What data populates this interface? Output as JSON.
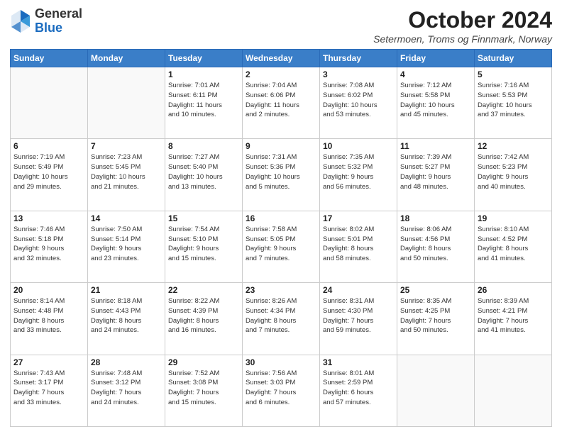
{
  "header": {
    "logo_general": "General",
    "logo_blue": "Blue",
    "month_title": "October 2024",
    "location": "Setermoen, Troms og Finnmark, Norway"
  },
  "days_of_week": [
    "Sunday",
    "Monday",
    "Tuesday",
    "Wednesday",
    "Thursday",
    "Friday",
    "Saturday"
  ],
  "weeks": [
    [
      {
        "day": "",
        "info": ""
      },
      {
        "day": "",
        "info": ""
      },
      {
        "day": "1",
        "info": "Sunrise: 7:01 AM\nSunset: 6:11 PM\nDaylight: 11 hours\nand 10 minutes."
      },
      {
        "day": "2",
        "info": "Sunrise: 7:04 AM\nSunset: 6:06 PM\nDaylight: 11 hours\nand 2 minutes."
      },
      {
        "day": "3",
        "info": "Sunrise: 7:08 AM\nSunset: 6:02 PM\nDaylight: 10 hours\nand 53 minutes."
      },
      {
        "day": "4",
        "info": "Sunrise: 7:12 AM\nSunset: 5:58 PM\nDaylight: 10 hours\nand 45 minutes."
      },
      {
        "day": "5",
        "info": "Sunrise: 7:16 AM\nSunset: 5:53 PM\nDaylight: 10 hours\nand 37 minutes."
      }
    ],
    [
      {
        "day": "6",
        "info": "Sunrise: 7:19 AM\nSunset: 5:49 PM\nDaylight: 10 hours\nand 29 minutes."
      },
      {
        "day": "7",
        "info": "Sunrise: 7:23 AM\nSunset: 5:45 PM\nDaylight: 10 hours\nand 21 minutes."
      },
      {
        "day": "8",
        "info": "Sunrise: 7:27 AM\nSunset: 5:40 PM\nDaylight: 10 hours\nand 13 minutes."
      },
      {
        "day": "9",
        "info": "Sunrise: 7:31 AM\nSunset: 5:36 PM\nDaylight: 10 hours\nand 5 minutes."
      },
      {
        "day": "10",
        "info": "Sunrise: 7:35 AM\nSunset: 5:32 PM\nDaylight: 9 hours\nand 56 minutes."
      },
      {
        "day": "11",
        "info": "Sunrise: 7:39 AM\nSunset: 5:27 PM\nDaylight: 9 hours\nand 48 minutes."
      },
      {
        "day": "12",
        "info": "Sunrise: 7:42 AM\nSunset: 5:23 PM\nDaylight: 9 hours\nand 40 minutes."
      }
    ],
    [
      {
        "day": "13",
        "info": "Sunrise: 7:46 AM\nSunset: 5:18 PM\nDaylight: 9 hours\nand 32 minutes."
      },
      {
        "day": "14",
        "info": "Sunrise: 7:50 AM\nSunset: 5:14 PM\nDaylight: 9 hours\nand 23 minutes."
      },
      {
        "day": "15",
        "info": "Sunrise: 7:54 AM\nSunset: 5:10 PM\nDaylight: 9 hours\nand 15 minutes."
      },
      {
        "day": "16",
        "info": "Sunrise: 7:58 AM\nSunset: 5:05 PM\nDaylight: 9 hours\nand 7 minutes."
      },
      {
        "day": "17",
        "info": "Sunrise: 8:02 AM\nSunset: 5:01 PM\nDaylight: 8 hours\nand 58 minutes."
      },
      {
        "day": "18",
        "info": "Sunrise: 8:06 AM\nSunset: 4:56 PM\nDaylight: 8 hours\nand 50 minutes."
      },
      {
        "day": "19",
        "info": "Sunrise: 8:10 AM\nSunset: 4:52 PM\nDaylight: 8 hours\nand 41 minutes."
      }
    ],
    [
      {
        "day": "20",
        "info": "Sunrise: 8:14 AM\nSunset: 4:48 PM\nDaylight: 8 hours\nand 33 minutes."
      },
      {
        "day": "21",
        "info": "Sunrise: 8:18 AM\nSunset: 4:43 PM\nDaylight: 8 hours\nand 24 minutes."
      },
      {
        "day": "22",
        "info": "Sunrise: 8:22 AM\nSunset: 4:39 PM\nDaylight: 8 hours\nand 16 minutes."
      },
      {
        "day": "23",
        "info": "Sunrise: 8:26 AM\nSunset: 4:34 PM\nDaylight: 8 hours\nand 7 minutes."
      },
      {
        "day": "24",
        "info": "Sunrise: 8:31 AM\nSunset: 4:30 PM\nDaylight: 7 hours\nand 59 minutes."
      },
      {
        "day": "25",
        "info": "Sunrise: 8:35 AM\nSunset: 4:25 PM\nDaylight: 7 hours\nand 50 minutes."
      },
      {
        "day": "26",
        "info": "Sunrise: 8:39 AM\nSunset: 4:21 PM\nDaylight: 7 hours\nand 41 minutes."
      }
    ],
    [
      {
        "day": "27",
        "info": "Sunrise: 7:43 AM\nSunset: 3:17 PM\nDaylight: 7 hours\nand 33 minutes."
      },
      {
        "day": "28",
        "info": "Sunrise: 7:48 AM\nSunset: 3:12 PM\nDaylight: 7 hours\nand 24 minutes."
      },
      {
        "day": "29",
        "info": "Sunrise: 7:52 AM\nSunset: 3:08 PM\nDaylight: 7 hours\nand 15 minutes."
      },
      {
        "day": "30",
        "info": "Sunrise: 7:56 AM\nSunset: 3:03 PM\nDaylight: 7 hours\nand 6 minutes."
      },
      {
        "day": "31",
        "info": "Sunrise: 8:01 AM\nSunset: 2:59 PM\nDaylight: 6 hours\nand 57 minutes."
      },
      {
        "day": "",
        "info": ""
      },
      {
        "day": "",
        "info": ""
      }
    ]
  ]
}
